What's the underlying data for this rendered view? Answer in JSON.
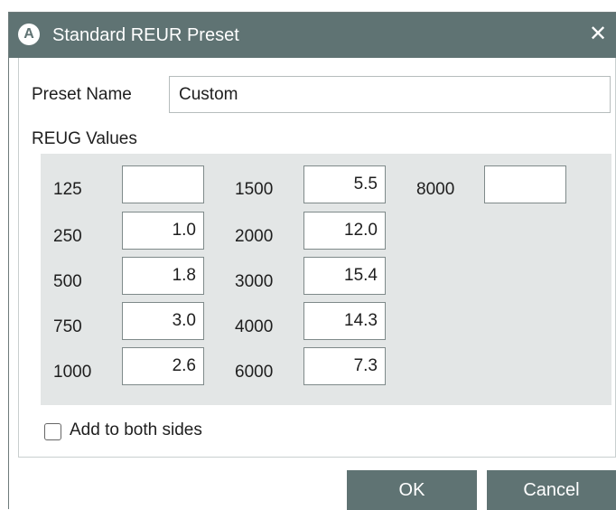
{
  "window": {
    "title": "Standard REUR Preset",
    "icon_letter": "A",
    "close_glyph": "✕"
  },
  "preset": {
    "label": "Preset Name",
    "value": "Custom"
  },
  "values_section": {
    "label": "REUG Values"
  },
  "frequencies": [
    {
      "freq": "125",
      "value": ""
    },
    {
      "freq": "250",
      "value": "1.0"
    },
    {
      "freq": "500",
      "value": "1.8"
    },
    {
      "freq": "750",
      "value": "3.0"
    },
    {
      "freq": "1000",
      "value": "2.6"
    },
    {
      "freq": "1500",
      "value": "5.5"
    },
    {
      "freq": "2000",
      "value": "12.0"
    },
    {
      "freq": "3000",
      "value": "15.4"
    },
    {
      "freq": "4000",
      "value": "14.3"
    },
    {
      "freq": "6000",
      "value": "7.3"
    },
    {
      "freq": "8000",
      "value": ""
    }
  ],
  "options": {
    "add_both_sides_label": "Add to both sides",
    "add_both_sides_checked": false
  },
  "buttons": {
    "ok": "OK",
    "cancel": "Cancel"
  },
  "colors": {
    "titlebar": "#5f7373",
    "panel": "#e3e6e6",
    "button": "#5f7373"
  }
}
